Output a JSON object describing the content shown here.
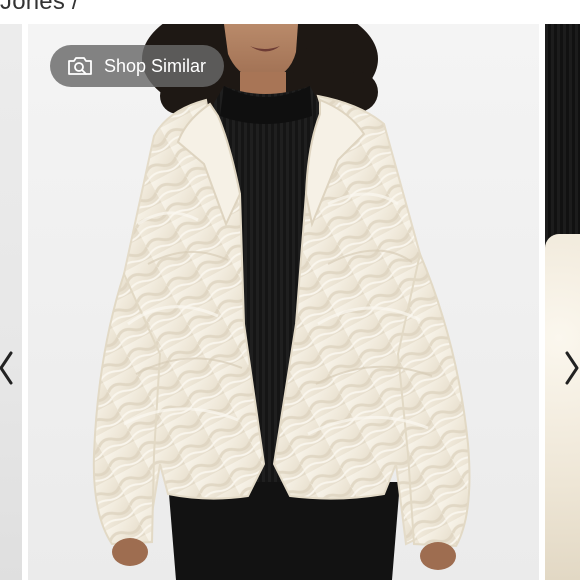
{
  "top_caption": "Jones /",
  "shop_similar": {
    "label": "Shop Similar",
    "icon": "camera-search-icon"
  },
  "carousel": {
    "prev_icon": "chevron-left-icon",
    "next_icon": "chevron-right-icon"
  },
  "product_image": {
    "subject": "cream faux fur jacket worn over black turtleneck"
  },
  "colors": {
    "background": "#ffffff",
    "pill": "#696969",
    "jacket": "#f1ebde",
    "sweater": "#161616"
  }
}
